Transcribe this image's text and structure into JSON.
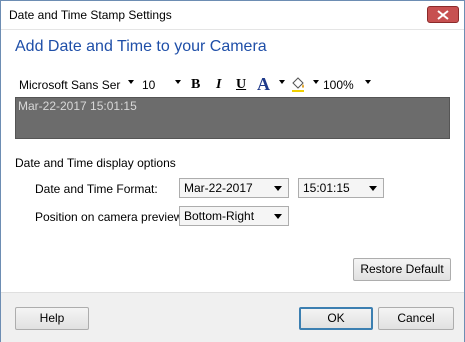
{
  "window": {
    "title": "Date and Time Stamp Settings"
  },
  "header": {
    "heading": "Add Date and Time to your Camera"
  },
  "toolbar": {
    "font_name": "Microsoft Sans Ser",
    "font_size": "10",
    "bold": "B",
    "italic": "I",
    "underline": "U",
    "font_color": "A",
    "zoom": "100%"
  },
  "preview": {
    "stamp_text": "Mar-22-2017 15:01:15"
  },
  "options": {
    "section_label": "Date and Time display options",
    "format_label": "Date and Time Format:",
    "date_format": "Mar-22-2017",
    "time_format": "15:01:15",
    "position_label": "Position on camera preview:",
    "position_value": "Bottom-Right"
  },
  "buttons": {
    "restore_default": "Restore Default",
    "help": "Help",
    "ok": "OK",
    "cancel": "Cancel"
  },
  "colors": {
    "heading": "#1f4fa8",
    "preview_bg": "#6c6c6c",
    "close_button": "#c75050"
  }
}
